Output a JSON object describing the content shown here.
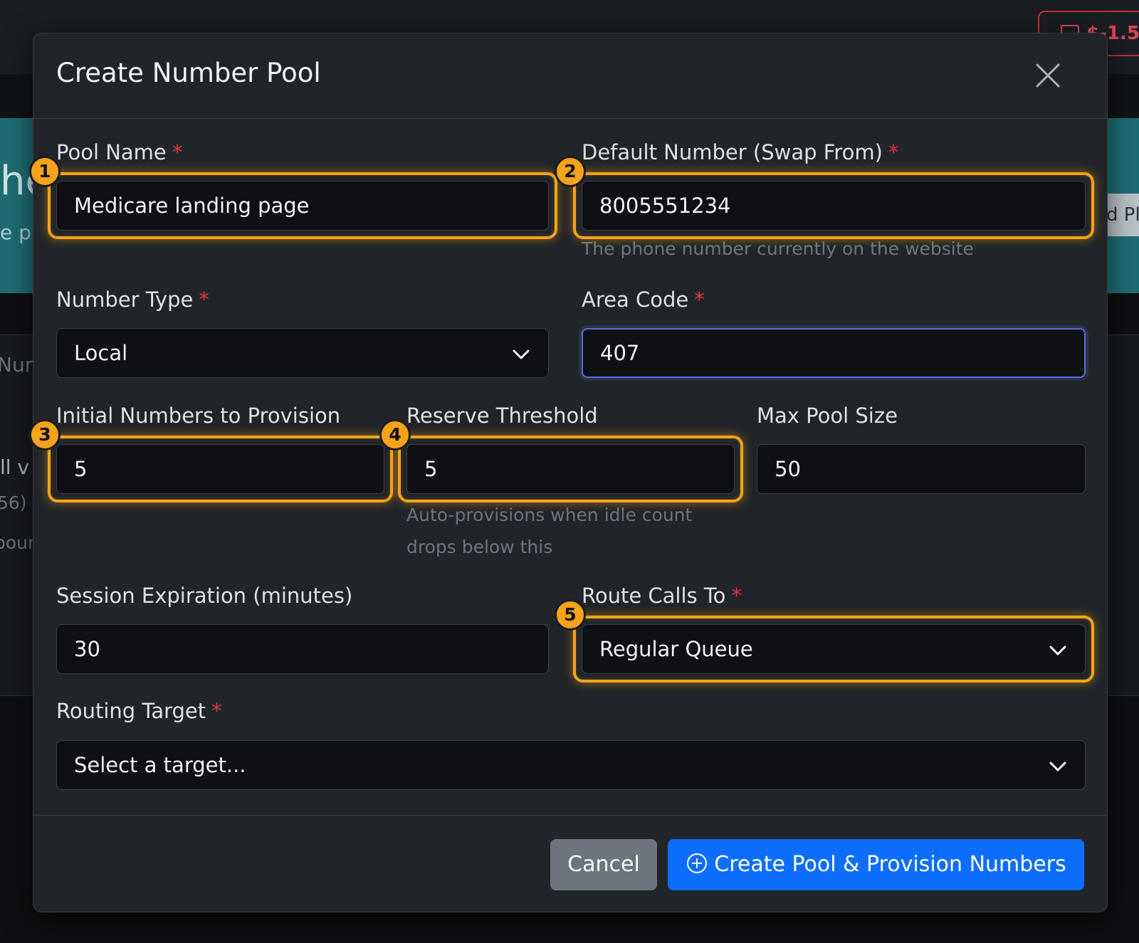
{
  "background": {
    "balance": "$-1.5",
    "hero_title": "he",
    "hero_subtitle": "e p",
    "hero_button": "d Pl",
    "text_num": "Nur",
    "text_all": "ll v",
    "text_count": "56)",
    "text_pour": "pour"
  },
  "modal": {
    "title": "Create Number Pool",
    "fields": {
      "pool_name": {
        "label": "Pool Name",
        "required": "*",
        "value": "Medicare landing page"
      },
      "default_number": {
        "label": "Default Number (Swap From)",
        "required": "*",
        "value": "8005551234",
        "help": "The phone number currently on the website"
      },
      "number_type": {
        "label": "Number Type",
        "required": "*",
        "value": "Local"
      },
      "area_code": {
        "label": "Area Code",
        "required": "*",
        "value": "407"
      },
      "initial_numbers": {
        "label": "Initial Numbers to Provision",
        "value": "5"
      },
      "reserve_threshold": {
        "label": "Reserve Threshold",
        "value": "5",
        "help": "Auto-provisions when idle count drops below this"
      },
      "max_pool_size": {
        "label": "Max Pool Size",
        "value": "50"
      },
      "session_expiration": {
        "label": "Session Expiration (minutes)",
        "value": "30"
      },
      "route_calls_to": {
        "label": "Route Calls To",
        "required": "*",
        "value": "Regular Queue"
      },
      "routing_target": {
        "label": "Routing Target",
        "required": "*",
        "placeholder": "Select a target..."
      }
    },
    "buttons": {
      "cancel": "Cancel",
      "create": "Create Pool & Provision Numbers"
    }
  },
  "annotations": [
    "1",
    "2",
    "3",
    "4",
    "5"
  ],
  "colors": {
    "highlight": "#f5a31a",
    "primary": "#0d6efd",
    "required": "#dc3545",
    "focus_border": "#5d6ae0"
  }
}
